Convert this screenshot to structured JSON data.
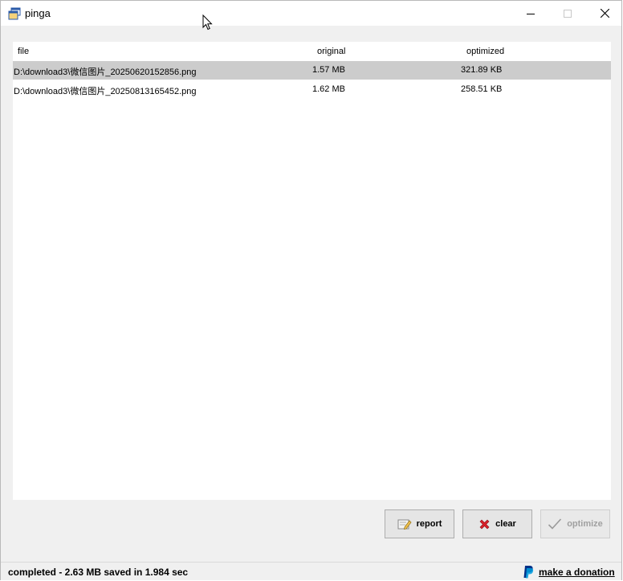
{
  "window": {
    "title": "pinga",
    "icon": "app-window-icon"
  },
  "list": {
    "columns": {
      "file": "file",
      "original": "original",
      "optimized": "optimized"
    },
    "rows": [
      {
        "file": "D:\\download3\\微信图片_20250620152856.png",
        "original": "1.57 MB",
        "optimized": "321.89 KB",
        "selected": true
      },
      {
        "file": "D:\\download3\\微信图片_20250813165452.png",
        "original": "1.62 MB",
        "optimized": "258.51 KB",
        "selected": false
      }
    ]
  },
  "buttons": {
    "report": "report",
    "clear": "clear",
    "optimize": "optimize"
  },
  "status": {
    "text": "completed -  2.63 MB saved in 1.984 sec",
    "donate": "make a donation"
  },
  "colors": {
    "selected_row": "#cccccc",
    "client_bg": "#f0f0f0",
    "clear_icon": "#d8202a",
    "paypal_dark": "#003087",
    "paypal_light": "#009cde"
  }
}
